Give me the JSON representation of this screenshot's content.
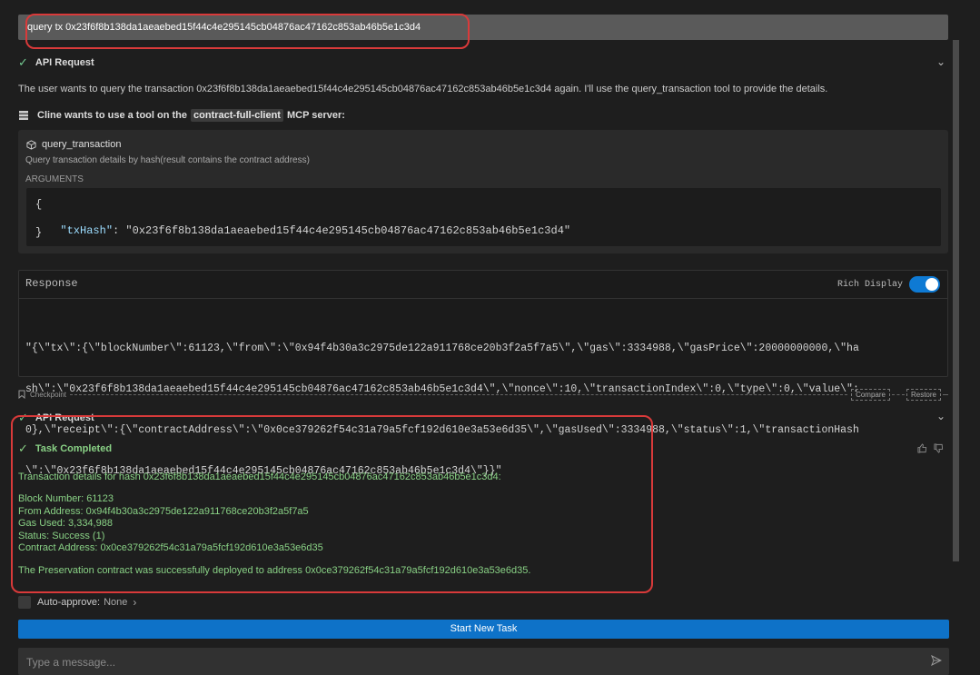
{
  "user_message": "query tx 0x23f6f8b138da1aeaebed15f44c4e295145cb04876ac47162c853ab46b5e1c3d4",
  "api_request_1": {
    "label": "API Request"
  },
  "assistant_text": "The user wants to query the transaction 0x23f6f8b138da1aeaebed15f44c4e295145cb04876ac47162c853ab46b5e1c3d4 again. I'll use the query_transaction tool to provide the details.",
  "mcp": {
    "prefix": "Cline wants to use a tool on the",
    "server": "contract-full-client",
    "suffix": "MCP server:"
  },
  "tool": {
    "name": "query_transaction",
    "description": "Query transaction details by hash(result contains the contract address)",
    "arguments_label": "ARGUMENTS",
    "args_open": "{",
    "arg_key": "\"txHash\"",
    "arg_colon": ": ",
    "arg_value": "\"0x23f6f8b138da1aeaebed15f44c4e295145cb04876ac47162c853ab46b5e1c3d4\"",
    "args_close": "}"
  },
  "response": {
    "title": "Response",
    "rich_display_label": "Rich Display",
    "rich_display_on": true,
    "lines": [
      "\"{\\\"tx\\\":{\\\"blockNumber\\\":61123,\\\"from\\\":\\\"0x94f4b30a3c2975de122a911768ce20b3f2a5f7a5\\\",\\\"gas\\\":3334988,\\\"gasPrice\\\":20000000000,\\\"ha",
      "sh\\\":\\\"0x23f6f8b138da1aeaebed15f44c4e295145cb04876ac47162c853ab46b5e1c3d4\\\",\\\"nonce\\\":10,\\\"transactionIndex\\\":0,\\\"type\\\":0,\\\"value\\\":",
      "0},\\\"receipt\\\":{\\\"contractAddress\\\":\\\"0x0ce379262f54c31a79a5fcf192d610e3a53e6d35\\\",\\\"gasUsed\\\":3334988,\\\"status\\\":1,\\\"transactionHash",
      "\\\":\\\"0x23f6f8b138da1aeaebed15f44c4e295145cb04876ac47162c853ab46b5e1c3d4\\\"}}\""
    ]
  },
  "checkpoint": {
    "label": "Checkpoint",
    "compare": "Compare",
    "restore": "Restore"
  },
  "api_request_2": {
    "label": "API Request"
  },
  "task_completed": {
    "label": "Task Completed",
    "intro": "Transaction details for hash 0x23f6f8b138da1aeaebed15f44c4e295145cb04876ac47162c853ab46b5e1c3d4:",
    "details": [
      "Block Number: 61123",
      "From Address: 0x94f4b30a3c2975de122a911768ce20b3f2a5f7a5",
      "Gas Used: 3,334,988",
      "Status: Success (1)",
      "Contract Address: 0x0ce379262f54c31a79a5fcf192d610e3a53e6d35"
    ],
    "summary": "The Preservation contract was successfully deployed to address 0x0ce379262f54c31a79a5fcf192d610e3a53e6d35."
  },
  "auto_approve": {
    "label": "Auto-approve:",
    "value": "None"
  },
  "start_new_task": "Start New Task",
  "message_input": {
    "placeholder": "Type a message..."
  },
  "colors": {
    "accent": "#0e72c8",
    "success": "#89d185",
    "annotation": "#d93a3a"
  },
  "icons": [
    "check-icon",
    "chevron-down-icon",
    "server-icon",
    "cube-icon",
    "bookmark-icon",
    "thumbs-up-icon",
    "thumbs-down-icon",
    "chevron-right-icon",
    "send-icon"
  ]
}
